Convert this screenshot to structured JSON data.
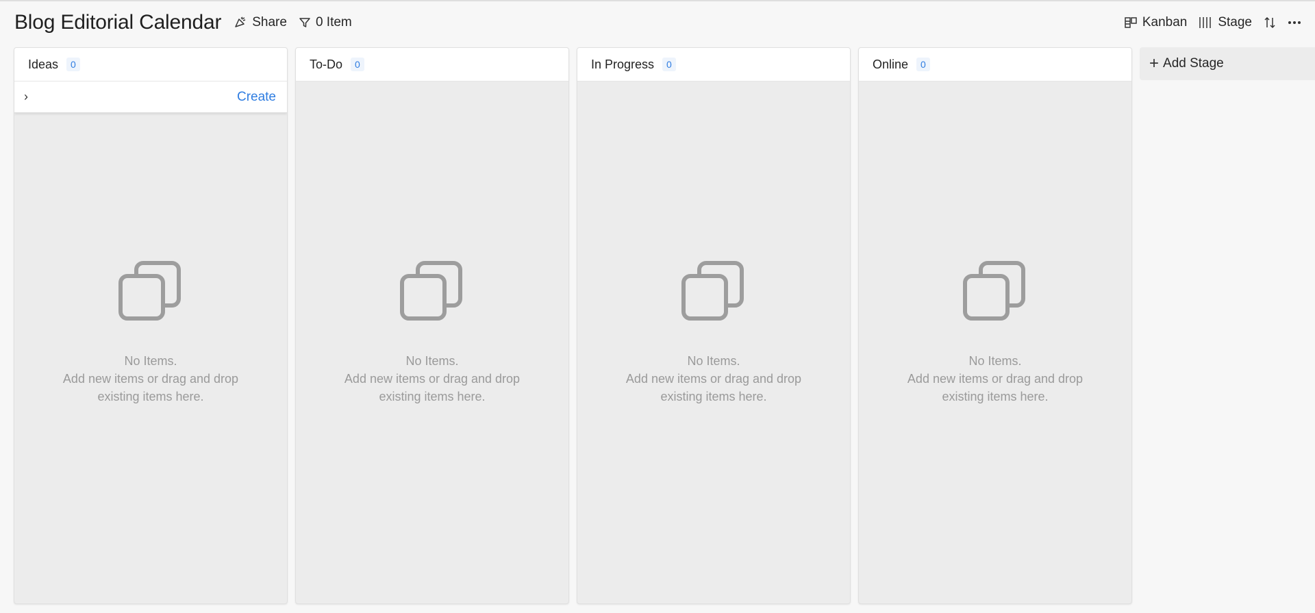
{
  "header": {
    "title": "Blog Editorial Calendar",
    "share_label": "Share",
    "filter_label": "0 Item",
    "view_label": "Kanban",
    "group_label": "Stage"
  },
  "columns": [
    {
      "title": "Ideas",
      "count": "0",
      "create_label": "Create",
      "empty_title": "No Items.",
      "empty_line1": "Add new items or drag and drop",
      "empty_line2": "existing items here."
    },
    {
      "title": "To-Do",
      "count": "0",
      "empty_title": "No Items.",
      "empty_line1": "Add new items or drag and drop",
      "empty_line2": "existing items here."
    },
    {
      "title": "In Progress",
      "count": "0",
      "empty_title": "No Items.",
      "empty_line1": "Add new items or drag and drop",
      "empty_line2": "existing items here."
    },
    {
      "title": "Online",
      "count": "0",
      "empty_title": "No Items.",
      "empty_line1": "Add new items or drag and drop",
      "empty_line2": "existing items here."
    }
  ],
  "add_stage_label": "Add Stage",
  "colors": {
    "accent": "#2f7de1",
    "column_bg": "#ececec",
    "empty_text": "#9a9a9a"
  },
  "icons": [
    "share-icon",
    "filter-icon",
    "kanban-icon",
    "stage-icon",
    "sort-icon",
    "more-icon",
    "empty-items-icon",
    "plus-icon",
    "chevron-right-icon"
  ]
}
